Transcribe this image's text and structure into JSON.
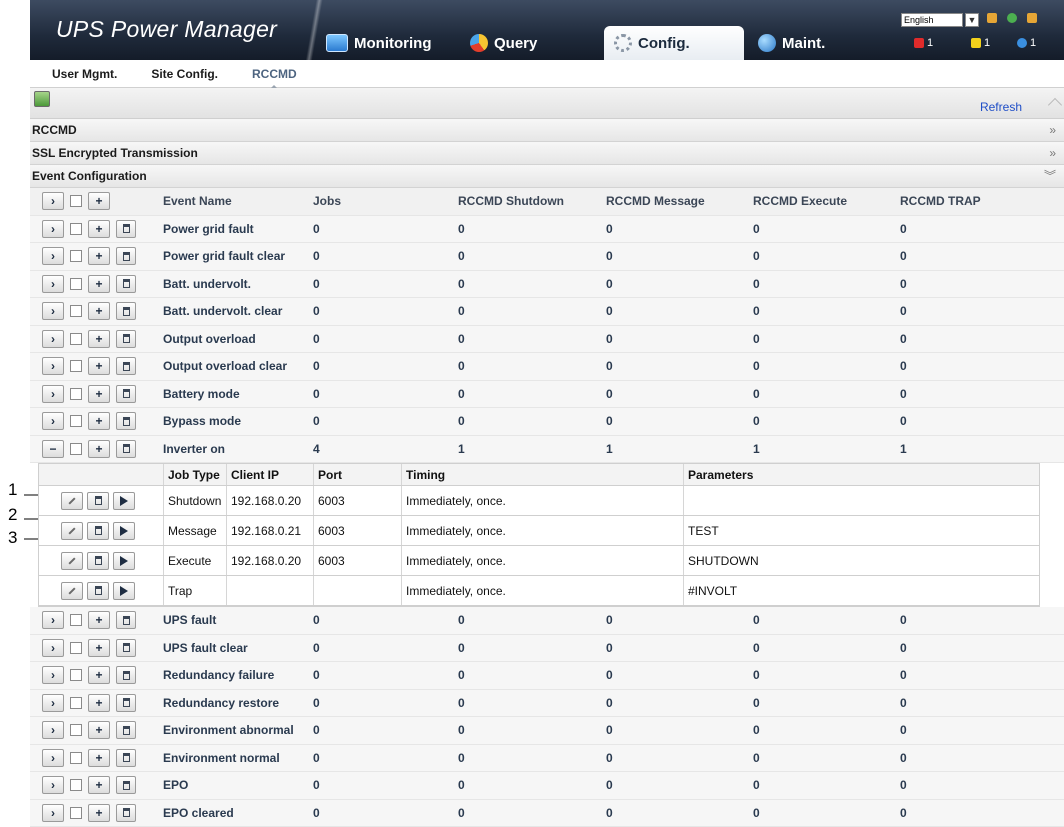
{
  "callouts": [
    "1",
    "2",
    "3"
  ],
  "header": {
    "app_title": "UPS Power Manager",
    "tabs": [
      {
        "label": "Monitoring",
        "icon": "monitor-icon"
      },
      {
        "label": "Query",
        "icon": "pie-chart-icon"
      },
      {
        "label": "Config.",
        "icon": "gear-icon",
        "active": true
      },
      {
        "label": "Maint.",
        "icon": "globe-wrench-icon"
      }
    ],
    "language": "English",
    "alarms": {
      "critical": "1",
      "major": "1",
      "minor": "1"
    }
  },
  "subnav": {
    "tabs": [
      "User Mgmt.",
      "Site Config.",
      "RCCMD"
    ],
    "active": "RCCMD"
  },
  "toolbar": {
    "refresh_label": "Refresh"
  },
  "sections": {
    "rccmd": "RCCMD",
    "ssl": "SSL Encrypted Transmission",
    "event_config": "Event Configuration"
  },
  "event_table": {
    "columns": [
      "Event Name",
      "Jobs",
      "RCCMD Shutdown",
      "RCCMD Message",
      "RCCMD Execute",
      "RCCMD TRAP"
    ],
    "rows_before": [
      {
        "name": "Power grid fault",
        "jobs": "0",
        "shutdown": "0",
        "message": "0",
        "execute": "0",
        "trap": "0"
      },
      {
        "name": "Power grid fault clear",
        "jobs": "0",
        "shutdown": "0",
        "message": "0",
        "execute": "0",
        "trap": "0"
      },
      {
        "name": "Batt. undervolt.",
        "jobs": "0",
        "shutdown": "0",
        "message": "0",
        "execute": "0",
        "trap": "0"
      },
      {
        "name": "Batt. undervolt. clear",
        "jobs": "0",
        "shutdown": "0",
        "message": "0",
        "execute": "0",
        "trap": "0"
      },
      {
        "name": "Output overload",
        "jobs": "0",
        "shutdown": "0",
        "message": "0",
        "execute": "0",
        "trap": "0"
      },
      {
        "name": "Output overload clear",
        "jobs": "0",
        "shutdown": "0",
        "message": "0",
        "execute": "0",
        "trap": "0"
      },
      {
        "name": "Battery mode",
        "jobs": "0",
        "shutdown": "0",
        "message": "0",
        "execute": "0",
        "trap": "0"
      },
      {
        "name": "Bypass mode",
        "jobs": "0",
        "shutdown": "0",
        "message": "0",
        "execute": "0",
        "trap": "0"
      }
    ],
    "expanded_row": {
      "name": "Inverter on",
      "jobs": "4",
      "shutdown": "1",
      "message": "1",
      "execute": "1",
      "trap": "1"
    },
    "rows_after": [
      {
        "name": "UPS fault",
        "jobs": "0",
        "shutdown": "0",
        "message": "0",
        "execute": "0",
        "trap": "0"
      },
      {
        "name": "UPS fault clear",
        "jobs": "0",
        "shutdown": "0",
        "message": "0",
        "execute": "0",
        "trap": "0"
      },
      {
        "name": "Redundancy failure",
        "jobs": "0",
        "shutdown": "0",
        "message": "0",
        "execute": "0",
        "trap": "0"
      },
      {
        "name": "Redundancy restore",
        "jobs": "0",
        "shutdown": "0",
        "message": "0",
        "execute": "0",
        "trap": "0"
      },
      {
        "name": "Environment abnormal",
        "jobs": "0",
        "shutdown": "0",
        "message": "0",
        "execute": "0",
        "trap": "0"
      },
      {
        "name": "Environment normal",
        "jobs": "0",
        "shutdown": "0",
        "message": "0",
        "execute": "0",
        "trap": "0"
      },
      {
        "name": "EPO",
        "jobs": "0",
        "shutdown": "0",
        "message": "0",
        "execute": "0",
        "trap": "0"
      },
      {
        "name": "EPO cleared",
        "jobs": "0",
        "shutdown": "0",
        "message": "0",
        "execute": "0",
        "trap": "0"
      }
    ]
  },
  "jobs_table": {
    "columns": [
      "Job Type",
      "Client IP",
      "Port",
      "Timing",
      "Parameters"
    ],
    "rows": [
      {
        "type": "Shutdown",
        "ip": "192.168.0.20",
        "port": "6003",
        "timing": "Immediately, once.",
        "params": ""
      },
      {
        "type": "Message",
        "ip": "192.168.0.21",
        "port": "6003",
        "timing": "Immediately, once.",
        "params": "TEST"
      },
      {
        "type": "Execute",
        "ip": "192.168.0.20",
        "port": "6003",
        "timing": "Immediately, once.",
        "params": "SHUTDOWN"
      },
      {
        "type": "Trap",
        "ip": "",
        "port": "",
        "timing": "Immediately, once.",
        "params": "#INVOLT"
      }
    ]
  }
}
